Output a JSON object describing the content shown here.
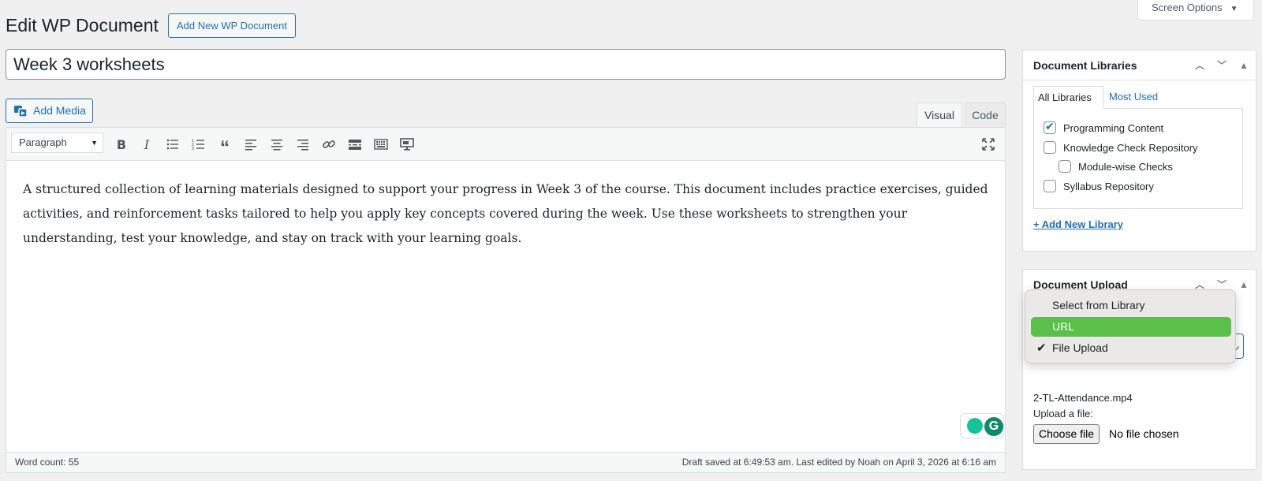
{
  "header": {
    "title": "Edit WP Document",
    "add_new_label": "Add New WP Document",
    "screen_options_label": "Screen Options"
  },
  "post": {
    "title": "Week 3 worksheets"
  },
  "editor": {
    "add_media_label": "Add Media",
    "tabs": {
      "visual": "Visual",
      "code": "Code"
    },
    "format_value": "Paragraph",
    "content": "A structured collection of learning materials designed to support your progress in Week 3 of the course. This document includes practice exercises, guided activities, and reinforcement tasks tailored to help you apply key concepts covered during the week. Use these worksheets to strengthen your understanding, test your knowledge, and stay on track with your learning goals.",
    "word_count": "Word count: 55",
    "draft_status": "Draft saved at 6:49:53 am. Last edited by Noah on April 3, 2026 at 6:16 am"
  },
  "libraries_box": {
    "title": "Document Libraries",
    "tabs": {
      "all": "All Libraries",
      "used": "Most Used"
    },
    "items": [
      {
        "label": "Programming Content",
        "checked": true
      },
      {
        "label": "Knowledge Check Repository",
        "checked": false
      },
      {
        "label": "Module-wise Checks",
        "checked": false
      },
      {
        "label": "Syllabus Repository",
        "checked": false
      }
    ],
    "add_link": "+ Add New Library"
  },
  "upload_box": {
    "title": "Document Upload",
    "dropdown_options": [
      {
        "label": "Select from Library"
      },
      {
        "label": "URL"
      },
      {
        "label": "File Upload"
      }
    ],
    "file_name": "2-TL-Attendance.mp4",
    "upload_label": "Upload a file:",
    "choose_file_label": "Choose file",
    "no_file_text": "No file chosen"
  },
  "colors": {
    "accent": "#2271b1",
    "dropdown_highlight": "#5ac04a"
  }
}
